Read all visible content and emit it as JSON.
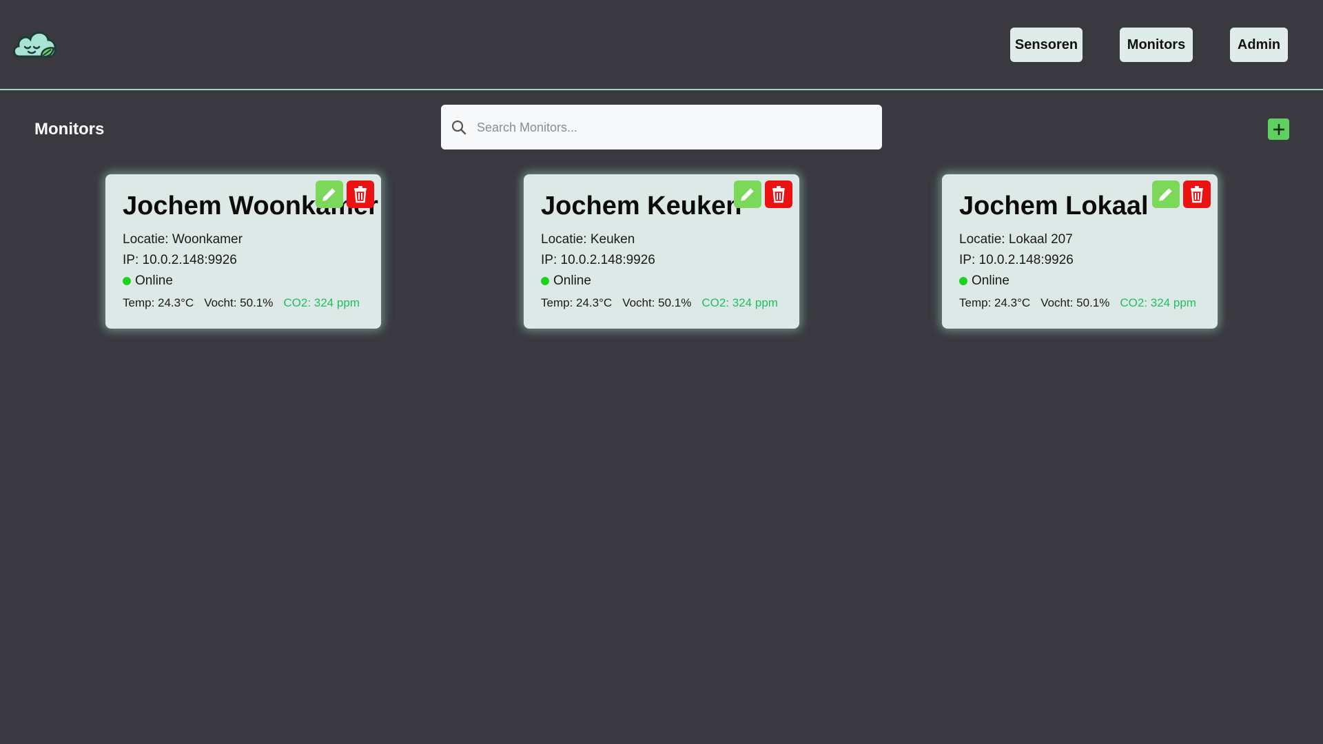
{
  "header": {
    "logo_icon": "cloud-leaf-logo-icon",
    "nav": [
      {
        "label": "Sensoren"
      },
      {
        "label": "Monitors"
      },
      {
        "label": "Admin"
      }
    ]
  },
  "main": {
    "title": "Monitors",
    "search": {
      "placeholder": "Search Monitors...",
      "value": ""
    },
    "add_icon": "plus-icon"
  },
  "monitors": [
    {
      "name": "Jochem Woonkamer",
      "location": "Locatie: Woonkamer",
      "ip": "IP: 10.0.2.148:9926",
      "status": "Online",
      "temp": "Temp: 24.3°C",
      "humidity": "Vocht: 50.1%",
      "co2": "CO2: 324 ppm"
    },
    {
      "name": "Jochem Keuken",
      "location": "Locatie: Keuken",
      "ip": "IP: 10.0.2.148:9926",
      "status": "Online",
      "temp": "Temp: 24.3°C",
      "humidity": "Vocht: 50.1%",
      "co2": "CO2: 324 ppm"
    },
    {
      "name": "Jochem Lokaal",
      "location": "Locatie: Lokaal 207",
      "ip": "IP: 10.0.2.148:9926",
      "status": "Online",
      "temp": "Temp: 24.3°C",
      "humidity": "Vocht: 50.1%",
      "co2": "CO2: 324 ppm"
    }
  ],
  "colors": {
    "background": "#39393f",
    "accent": "#9fd9c9",
    "card": "#dde9e6",
    "edit": "#7cd85b",
    "delete": "#ee1111",
    "online": "#19d419",
    "co2": "#1fbf62"
  }
}
